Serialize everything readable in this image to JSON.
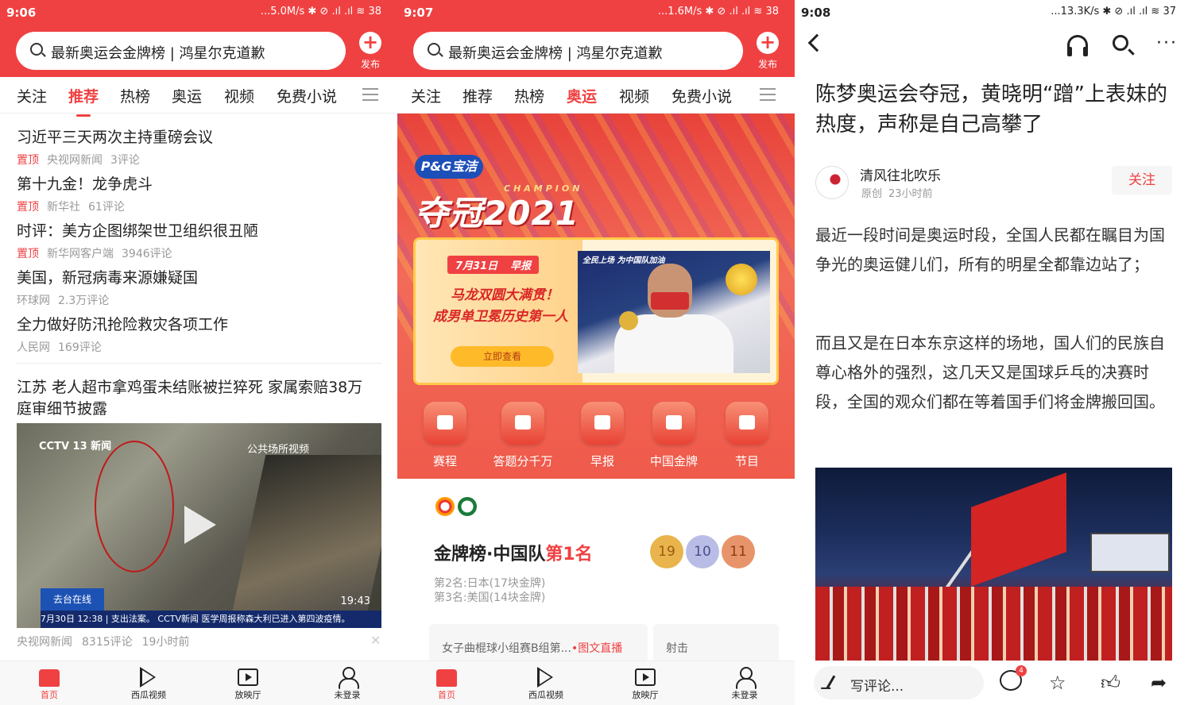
{
  "panels": [
    {
      "status": {
        "time": "9:06",
        "net": "...5.0M/s ✱ ⊘ .ıl .ıl ≋ 38"
      },
      "search": {
        "query": "最新奥运会金牌榜 | 鸿星尔克道歉",
        "publish_label": "发布"
      },
      "tabs": [
        "关注",
        "推荐",
        "热榜",
        "奥运",
        "视频",
        "免费小说"
      ],
      "active_tab": "推荐",
      "news": [
        {
          "title": "习近平三天两次主持重磅会议",
          "pin": "置顶",
          "source": "央视网新闻",
          "comments": "3评论"
        },
        {
          "title": "第十九金！龙争虎斗",
          "pin": "置顶",
          "source": "新华社",
          "comments": "61评论"
        },
        {
          "title": "时评：美方企图绑架世卫组织很丑陋",
          "pin": "置顶",
          "source": "新华网客户端",
          "comments": "3946评论"
        },
        {
          "title": "美国，新冠病毒来源嫌疑国",
          "pin": "",
          "source": "环球网",
          "comments": "2.3万评论"
        },
        {
          "title": "全力做好防汛抢险救灾各项工作",
          "pin": "",
          "source": "人民网",
          "comments": "169评论"
        }
      ],
      "video_item": {
        "title": "江苏 老人超市拿鸡蛋未结账被拦猝死 家属索赔38万 庭审细节披露",
        "logo": "CCTV 13 新闻",
        "tag": "公共场所视频",
        "box": "去台在线",
        "ticker": "7月30日 12:38 | 支出法案。 CCTV新闻 医学周报称森大利已进入第四波疫情。",
        "duration": "19:43",
        "source": "央视网新闻",
        "comments": "8315评论",
        "time": "19小时前",
        "close": "✕"
      },
      "bottom_nav": [
        "首页",
        "西瓜视频",
        "放映厅",
        "未登录"
      ]
    },
    {
      "status": {
        "time": "9:07",
        "net": "...1.6M/s ✱ ⊘ .ıl .ıl ≋ 38"
      },
      "search": {
        "query": "最新奥运会金牌榜 | 鸿星尔克道歉",
        "publish_label": "发布"
      },
      "tabs": [
        "关注",
        "推荐",
        "热榜",
        "奥运",
        "视频",
        "免费小说"
      ],
      "active_tab": "奥运",
      "banner": {
        "brand": "P&G宝洁",
        "champion_title": "夺冠2021",
        "champion_sub": "CHAMPION",
        "date": "7月31日",
        "date_tag": "早报",
        "line1": "马龙双圆大满贯！",
        "line2": "成男单卫冕历史第一人",
        "button": "立即查看",
        "photo_caption": "全民上场 为中国队加油"
      },
      "icons": [
        "赛程",
        "答题分千万",
        "早报",
        "中国金牌",
        "节目"
      ],
      "medal_board": {
        "title_prefix": "金牌榜·中国队",
        "title_rank": "第1名",
        "gold": "19",
        "silver": "10",
        "bronze": "11",
        "second": "第2名:日本(17块金牌)",
        "third": "第3名:美国(14块金牌)"
      },
      "live": [
        {
          "text": "女子曲棍球小组赛B组第...",
          "tag": "•图文直播"
        },
        {
          "text": "射击",
          "tag": ""
        }
      ],
      "bottom_nav": [
        "首页",
        "西瓜视频",
        "放映厅",
        "未登录"
      ]
    },
    {
      "status": {
        "time": "9:08",
        "net": "...13.3K/s ✱ ⊘ .ıl .ıl ≋ 37"
      },
      "article": {
        "title": "陈梦奥运会夺冠，黄晓明“蹭”上表妹的热度，声称是自己高攀了",
        "author": "清风往北吹乐",
        "original": "原创",
        "time": "23小时前",
        "follow": "关注",
        "paragraphs": [
          "最近一段时间是奥运时段，全国人民都在瞩目为国争光的奥运健儿们，所有的明星全都靠边站了；",
          "而且又是在日本东京这样的场地，国人们的民族自尊心格外的强烈，这几天又是国球乒乓的决赛时段，全国的观众们都在等着国手们将金牌搬回国。"
        ]
      },
      "bottom": {
        "comment_placeholder": "写评论...",
        "comment_count": "4"
      }
    }
  ],
  "colors": {
    "accent": "#f04142",
    "gold": "#e9b44c",
    "silver": "#b9bde6",
    "bronze": "#e8946a"
  }
}
